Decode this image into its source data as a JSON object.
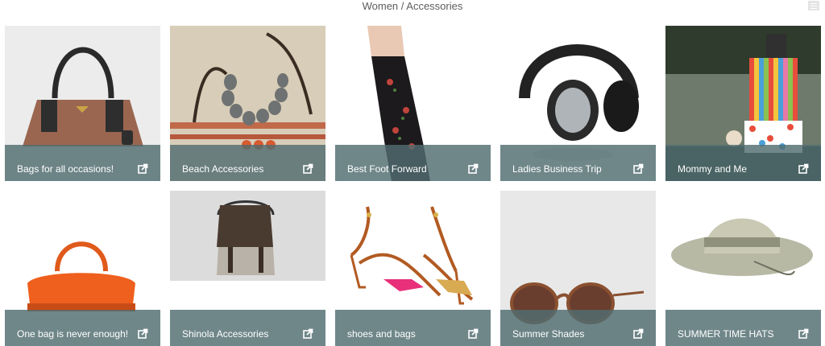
{
  "header": {
    "breadcrumb": "Women / Accessories",
    "menu_icon": "menu-icon"
  },
  "boards": [
    {
      "label": "Bags for all occasions!",
      "image": "brown-handbag"
    },
    {
      "label": "Beach Accessories",
      "image": "stone-necklace"
    },
    {
      "label": "Best Foot Forward",
      "image": "floral-sock"
    },
    {
      "label": "Ladies Business Trip",
      "image": "headphones"
    },
    {
      "label": "Mommy and Me",
      "image": "striped-apron"
    },
    {
      "label": "One bag is never enough!",
      "image": "orange-bag"
    },
    {
      "label": "Shinola Accessories",
      "image": "backpack"
    },
    {
      "label": "shoes and bags",
      "image": "strappy-sandals"
    },
    {
      "label": "Summer Shades",
      "image": "sunglasses"
    },
    {
      "label": "SUMMER TIME HATS",
      "image": "bucket-hat"
    }
  ],
  "share_icon": "share-icon"
}
